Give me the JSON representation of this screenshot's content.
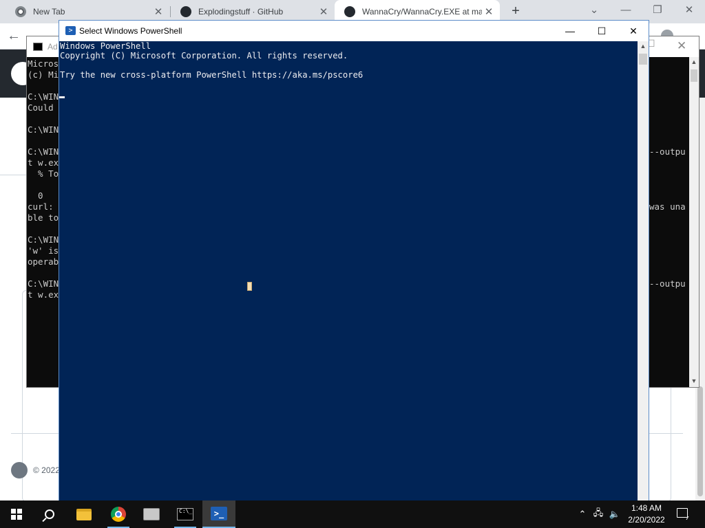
{
  "browser": {
    "tabs": [
      {
        "title": "New Tab",
        "icon": "chrome-icon"
      },
      {
        "title": "Explodingstuff · GitHub",
        "icon": "github-icon"
      },
      {
        "title": "WannaCry/WannaCry.EXE at mas",
        "icon": "github-icon"
      }
    ],
    "active_tab": 2,
    "new_tab_label": "+",
    "page": {
      "footer_copyright": "© 2022"
    }
  },
  "cmd_window": {
    "title": "Ad",
    "lines": [
      {
        "row": 0,
        "text": "Micros"
      },
      {
        "row": 1,
        "text": "(c) Mi"
      },
      {
        "row": 3,
        "text": "C:\\WIN"
      },
      {
        "row": 4,
        "text": "Could"
      },
      {
        "row": 6,
        "text": "C:\\WIN"
      },
      {
        "row": 8,
        "text": "C:\\WIN"
      },
      {
        "row": 9,
        "text": "t w.ex"
      },
      {
        "row": 10,
        "text": "  % To"
      },
      {
        "row": 12,
        "text": "  0"
      },
      {
        "row": 13,
        "text": "curl:"
      },
      {
        "row": 14,
        "text": "ble to"
      },
      {
        "row": 16,
        "text": "C:\\WIN"
      },
      {
        "row": 17,
        "text": "'w' is"
      },
      {
        "row": 18,
        "text": "operab"
      },
      {
        "row": 20,
        "text": "C:\\WIN"
      },
      {
        "row": 21,
        "text": "t w.ex"
      }
    ],
    "right_lines": [
      {
        "row": 8,
        "text": "--outpu"
      },
      {
        "row": 13,
        "text": "was una"
      },
      {
        "row": 20,
        "text": "--outpu"
      }
    ]
  },
  "powershell": {
    "title": "Select Windows PowerShell",
    "lines": [
      "Windows PowerShell",
      "Copyright (C) Microsoft Corporation. All rights reserved.",
      "",
      "Try the new cross-platform PowerShell https://aka.ms/pscore6"
    ],
    "colors": {
      "background": "#012456",
      "foreground": "#eeedf0"
    }
  },
  "taskbar": {
    "apps": [
      {
        "name": "file-explorer"
      },
      {
        "name": "chrome"
      },
      {
        "name": "server-manager"
      },
      {
        "name": "command-prompt"
      },
      {
        "name": "powershell",
        "active": true
      }
    ],
    "clock": {
      "time": "1:48 AM",
      "date": "2/20/2022"
    }
  }
}
